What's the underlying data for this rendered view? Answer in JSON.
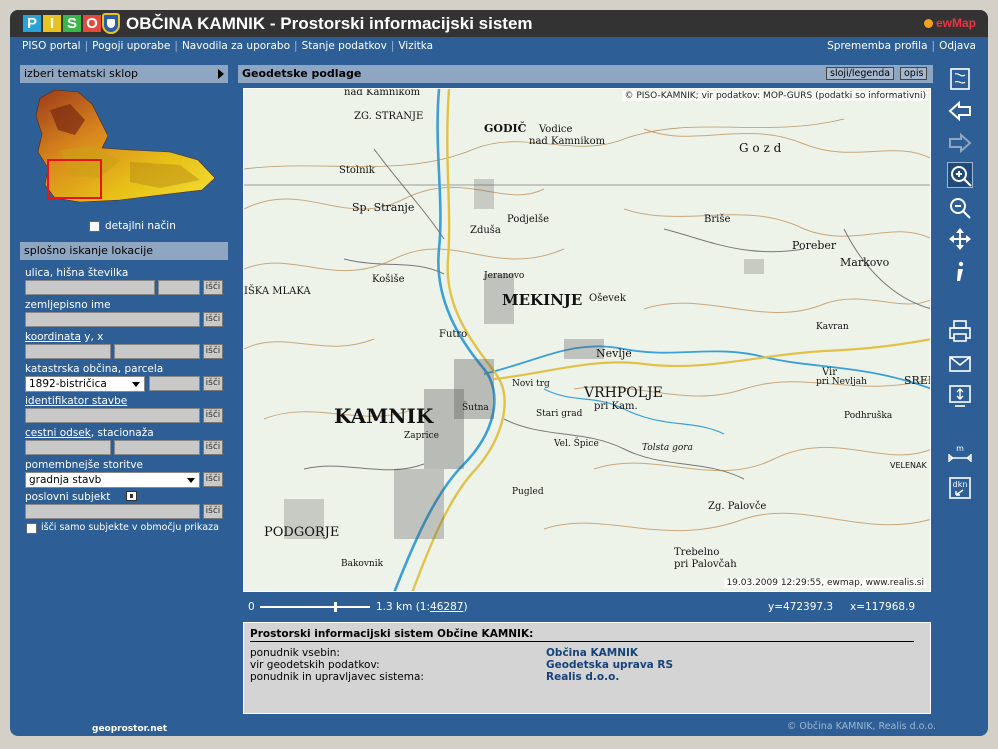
{
  "header": {
    "logo_letters": [
      "P",
      "I",
      "S",
      "O"
    ],
    "title": "OBČINA KAMNIK - Prostorski informacijski sistem",
    "brand": "ewMap"
  },
  "nav": {
    "left": [
      "PISO portal",
      "Pogoji uporabe",
      "Navodila za uporabo",
      "Stanje podatkov",
      "Vizitka"
    ],
    "right": [
      "Sprememba profila",
      "Odjava"
    ]
  },
  "left_panel": {
    "theme_header": "izberi tematski sklop",
    "detail_mode_label": "detajlni način",
    "search_header": "splošno iskanje lokacije",
    "search_button": "išči",
    "fields": {
      "street": "ulica, hišna številka",
      "place_name": "zemljepisno ime",
      "coord_link": "koordinata",
      "coord_suffix": "y, x",
      "cadastre": "katastrska občina, parcela",
      "cadastre_value": "1892-bistričica",
      "building_id": "identifikator stavbe",
      "road_link": "cestni odsek",
      "road_suffix": ", stacionaža",
      "services": "pomembnejše storitve",
      "services_value": "gradnja stavb",
      "business": "poslovni subjekt",
      "only_area": "išči samo subjekte v območju prikaza"
    }
  },
  "map": {
    "header": "Geodetske podlage",
    "btn_layers": "sloji/legenda",
    "btn_desc": "opis",
    "copyright": "© PISO-KAMNIK; vir podatkov: MOP-GURS (podatki so informativni)",
    "date": "19.03.2009 12:29:55, ewmap, www.realis.si",
    "places": {
      "zg_stranje": "ZG. STRANJE",
      "nad_kamnikom": "nad Kamnikom",
      "godic": "GODIČ",
      "vodice": "Vodice",
      "nad_kamnikom2": "nad Kamnikom",
      "gozd": "G o z d",
      "stolnik": "Stolnik",
      "sp_stranje": "Sp. Stranje",
      "podjelse": "Podjelše",
      "zduse": "Zduša",
      "brise": "Briše",
      "poreber": "Poreber",
      "markovo": "Markovo",
      "koisce": "Košiše",
      "mlaka": "IŠKA MLAKA",
      "mekinje": "MEKINJE",
      "osevek": "Oševek",
      "jeranovo": "Jeranovo",
      "kavran": "Kavran",
      "futro": "Futro",
      "nevlje": "Nevlje",
      "sredna": "SRED",
      "kamnik": "KAMNIK",
      "vrhpolje": "VRHPOLJE",
      "pri_kam": "pri Kam.",
      "stari_grad": "Stari grad",
      "vir": "Vir",
      "pri_nevljah": "pri Nevljah",
      "podhruska": "Podhruška",
      "novi_trg": "Novi trg",
      "sutna": "Šutna",
      "zaprice": "Zaprice",
      "vel_spice": "Vel. Špice",
      "tolsta": "Tolsta gora",
      "podgorje": "PODGORJE",
      "pugled": "Pugled",
      "zg_palovce": "Zg. Palovče",
      "bakovnik": "Bakovnik",
      "trebelno": "Trebelno",
      "pri_palovcah": "pri Palovčah",
      "velenak": "VELENAK"
    }
  },
  "scale": {
    "zero": "0",
    "distance": "1.3 km",
    "ratio_prefix": "(1:",
    "ratio_value": "46287",
    "ratio_suffix": ")",
    "coord_y": "y=472397.3",
    "coord_x": "x=117968.9"
  },
  "info": {
    "title": "Prostorski informacijski sistem Občine KAMNIK:",
    "rows": [
      {
        "label": "ponudnik vsebin:",
        "value": "Občina KAMNIK"
      },
      {
        "label": "vir geodetskih podatkov:",
        "value": "Geodetska uprava RS"
      },
      {
        "label": "ponudnik in upravljavec sistema:",
        "value": "Realis d.o.o."
      }
    ]
  },
  "footer": {
    "left": "geoprostor.net",
    "right": "© Občina KAMNIK, Realis d.o.o."
  },
  "colors": {
    "panel_bg": "#2d5f96",
    "header_bar": "#333333",
    "section_head": "#8ea6c2",
    "logo_p": "#29a3d6",
    "logo_i": "#e8c21e",
    "logo_s": "#3cb64a",
    "logo_o": "#e24a3b"
  }
}
